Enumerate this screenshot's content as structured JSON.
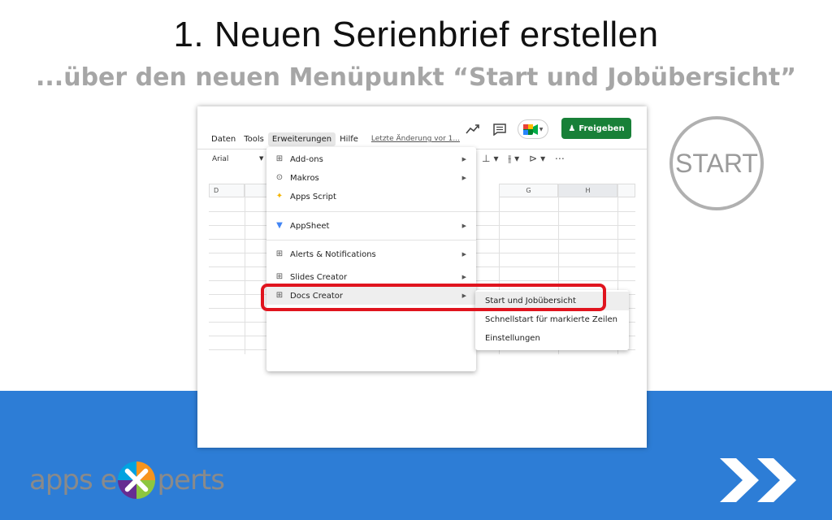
{
  "slide": {
    "title": "1. Neuen Serienbrief erstellen",
    "subtitle": "...über den neuen Menüpunkt “Start und Jobübersicht”",
    "start_label": "START",
    "logo_left": "apps e",
    "logo_right": "perts"
  },
  "sheet": {
    "menubar": [
      "Daten",
      "Tools",
      "Erweiterungen",
      "Hilfe"
    ],
    "last_change": "Letzte Änderung vor 1...",
    "share_label": "Freigeben",
    "font": "Arial",
    "col_headers": [
      "D",
      "G",
      "H"
    ]
  },
  "extensions_menu": {
    "items": [
      {
        "label": "Add-ons",
        "icon": "addon-icon",
        "submenu": true
      },
      {
        "label": "Makros",
        "icon": "play-icon",
        "submenu": true
      },
      {
        "label": "Apps Script",
        "icon": "apps-script-icon",
        "submenu": false
      },
      {
        "label": "AppSheet",
        "icon": "appsheet-icon",
        "submenu": true
      },
      {
        "label": "Alerts & Notifications",
        "icon": "addon-icon",
        "submenu": true
      },
      {
        "label": "Slides Creator",
        "icon": "addon-icon",
        "submenu": true
      },
      {
        "label": "Docs Creator",
        "icon": "addon-icon",
        "submenu": true
      }
    ]
  },
  "docs_creator_submenu": {
    "items": [
      "Start und Jobübersicht",
      "Schnellstart für markierte Zeilen",
      "Einstellungen"
    ]
  },
  "colors": {
    "band_blue": "#2d7dd6",
    "highlight_red": "#e0141e",
    "share_green": "#188038"
  }
}
